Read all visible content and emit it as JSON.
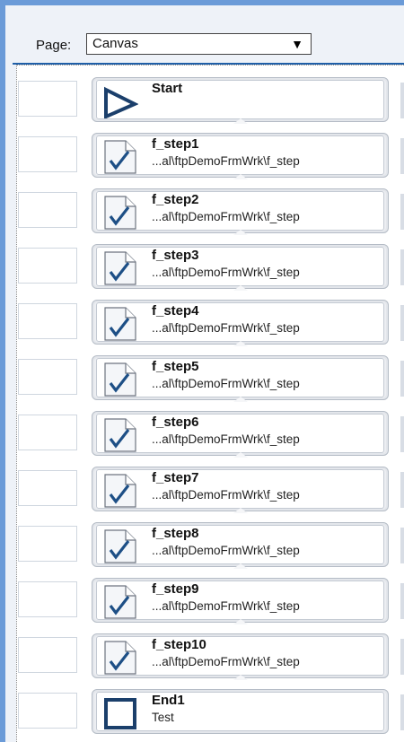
{
  "toolbar": {
    "page_label": "Page:",
    "page_value": "Canvas",
    "dropdown_arrow": "▼"
  },
  "steps": [
    {
      "title": "Start",
      "subtitle": "",
      "icon": "start-icon"
    },
    {
      "title": "f_step1",
      "subtitle": "...al\\ftpDemoFrmWrk\\f_step",
      "icon": "document-check-icon"
    },
    {
      "title": "f_step2",
      "subtitle": "...al\\ftpDemoFrmWrk\\f_step",
      "icon": "document-check-icon"
    },
    {
      "title": "f_step3",
      "subtitle": "...al\\ftpDemoFrmWrk\\f_step",
      "icon": "document-check-icon"
    },
    {
      "title": "f_step4",
      "subtitle": "...al\\ftpDemoFrmWrk\\f_step",
      "icon": "document-check-icon"
    },
    {
      "title": "f_step5",
      "subtitle": "...al\\ftpDemoFrmWrk\\f_step",
      "icon": "document-check-icon"
    },
    {
      "title": "f_step6",
      "subtitle": "...al\\ftpDemoFrmWrk\\f_step",
      "icon": "document-check-icon"
    },
    {
      "title": "f_step7",
      "subtitle": "...al\\ftpDemoFrmWrk\\f_step",
      "icon": "document-check-icon"
    },
    {
      "title": "f_step8",
      "subtitle": "...al\\ftpDemoFrmWrk\\f_step",
      "icon": "document-check-icon"
    },
    {
      "title": "f_step9",
      "subtitle": "...al\\ftpDemoFrmWrk\\f_step",
      "icon": "document-check-icon"
    },
    {
      "title": "f_step10",
      "subtitle": "...al\\ftpDemoFrmWrk\\f_step",
      "icon": "document-check-icon"
    },
    {
      "title": "End1",
      "subtitle": "Test",
      "icon": "end-icon"
    }
  ]
}
